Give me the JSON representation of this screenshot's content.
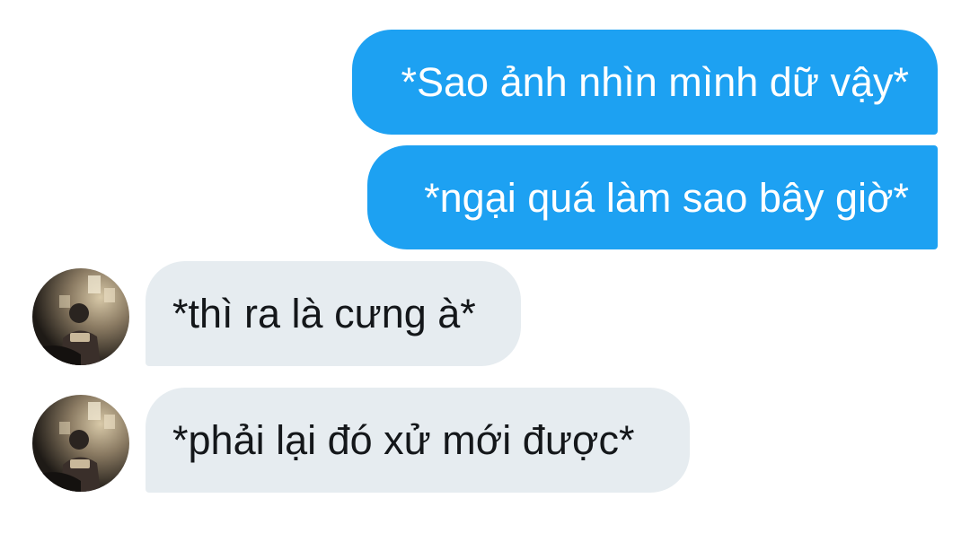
{
  "messages": [
    {
      "direction": "outgoing",
      "text": "*Sao ảnh nhìn mình dữ vậy*"
    },
    {
      "direction": "outgoing",
      "text": "*ngại quá làm sao bây giờ*"
    },
    {
      "direction": "incoming",
      "text": "*thì ra là cưng à*"
    },
    {
      "direction": "incoming",
      "text": "*phải lại đó xử mới được*"
    }
  ],
  "colors": {
    "outgoing_bubble": "#1da1f2",
    "outgoing_text": "#ffffff",
    "incoming_bubble": "#e6ecf0",
    "incoming_text": "#14171a"
  },
  "icons": {
    "avatar": "contact-avatar-photo"
  }
}
